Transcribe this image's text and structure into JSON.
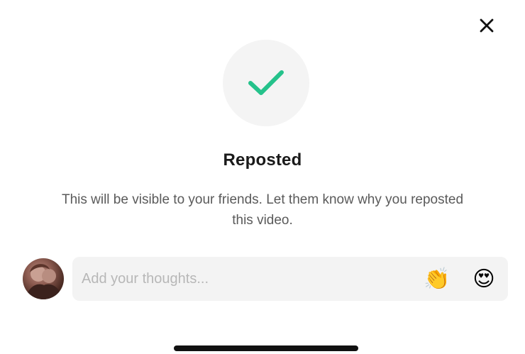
{
  "dialog": {
    "title": "Reposted",
    "message": "This will be visible to your friends. Let them know why you reposted this video.",
    "close_icon": "close-icon",
    "status_icon": "checkmark-icon",
    "accent_color": "#25c28b"
  },
  "comment": {
    "placeholder": "Add your thoughts...",
    "value": "",
    "avatar_icon": "user-avatar",
    "emojis": [
      {
        "name": "clapping-hands-emoji",
        "glyph": "👏"
      },
      {
        "name": "heart-eyes-emoji",
        "glyph": "😍"
      }
    ]
  }
}
